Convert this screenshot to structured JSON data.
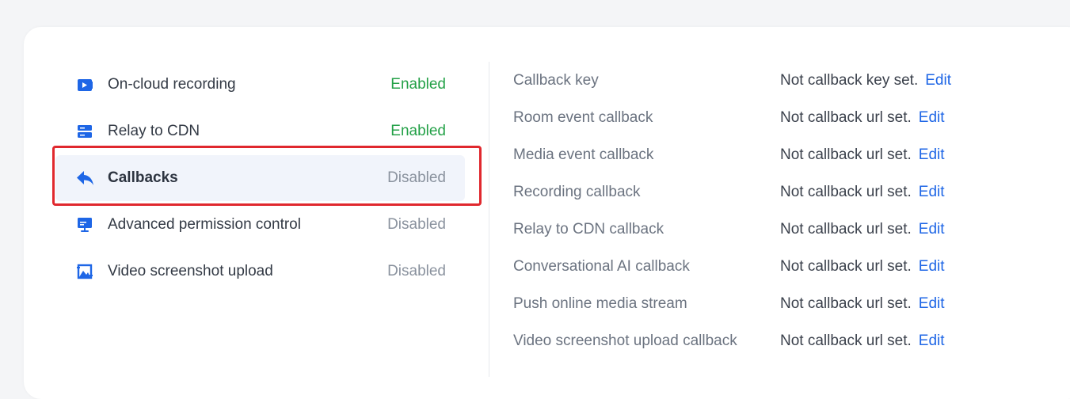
{
  "features": [
    {
      "label": "On-cloud recording",
      "status": "Enabled",
      "icon": "video-icon",
      "state": "enabled"
    },
    {
      "label": "Relay to CDN",
      "status": "Enabled",
      "icon": "server-icon",
      "state": "enabled"
    },
    {
      "label": "Callbacks",
      "status": "Disabled",
      "icon": "reply-icon",
      "state": "disabled",
      "selected": true
    },
    {
      "label": "Advanced permission control",
      "status": "Disabled",
      "icon": "monitor-icon",
      "state": "disabled"
    },
    {
      "label": "Video screenshot upload",
      "status": "Disabled",
      "icon": "image-icon",
      "state": "disabled"
    }
  ],
  "callbacks": [
    {
      "label": "Callback key",
      "value": "Not callback key set.",
      "edit": "Edit"
    },
    {
      "label": "Room event callback",
      "value": "Not callback url set.",
      "edit": "Edit"
    },
    {
      "label": "Media event callback",
      "value": "Not callback url set.",
      "edit": "Edit"
    },
    {
      "label": "Recording callback",
      "value": "Not callback url set.",
      "edit": "Edit"
    },
    {
      "label": "Relay to CDN callback",
      "value": "Not callback url set.",
      "edit": "Edit"
    },
    {
      "label": "Conversational AI callback",
      "value": "Not callback url set.",
      "edit": "Edit"
    },
    {
      "label": "Push online media stream",
      "value": "Not callback url set.",
      "edit": "Edit"
    },
    {
      "label": "Video screenshot upload callback",
      "value": "Not callback url set.",
      "edit": "Edit"
    }
  ],
  "colors": {
    "icon_blue": "#1e66e6",
    "enabled": "#24a148",
    "disabled": "#8a929e",
    "link": "#1e66e6",
    "highlight": "#e0282e"
  }
}
